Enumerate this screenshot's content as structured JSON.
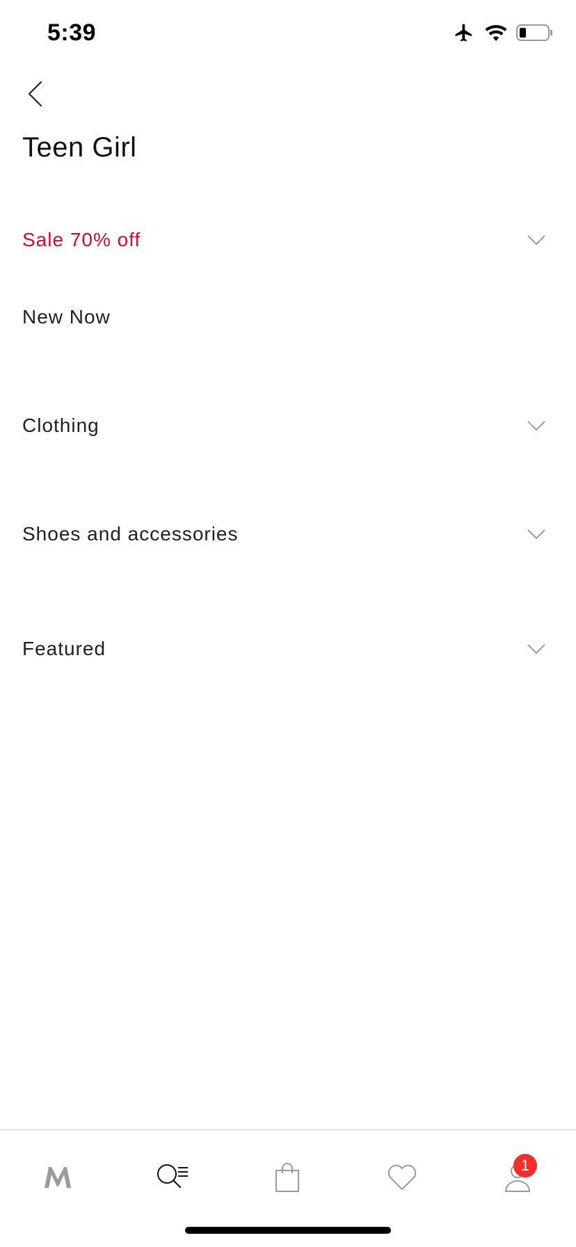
{
  "status_bar": {
    "time": "5:39",
    "icons": [
      "airplane-icon",
      "wifi-icon",
      "battery-icon"
    ]
  },
  "header": {
    "back_icon": "chevron-left-icon",
    "title": "Teen Girl"
  },
  "menu": {
    "items": [
      {
        "label": "Sale 70% off",
        "expandable": true,
        "highlight_color": "#c8102e"
      },
      {
        "label": "New Now",
        "expandable": false
      },
      {
        "label": "Clothing",
        "expandable": true
      },
      {
        "label": "Shoes and accessories",
        "expandable": true
      },
      {
        "label": "Featured",
        "expandable": true
      }
    ]
  },
  "tab_bar": {
    "tabs": [
      {
        "icon": "logo-m-icon"
      },
      {
        "icon": "search-menu-icon",
        "active": true
      },
      {
        "icon": "shopping-bag-icon"
      },
      {
        "icon": "heart-icon"
      },
      {
        "icon": "user-icon",
        "badge": "1"
      }
    ],
    "badge_color": "#f22e2e"
  }
}
